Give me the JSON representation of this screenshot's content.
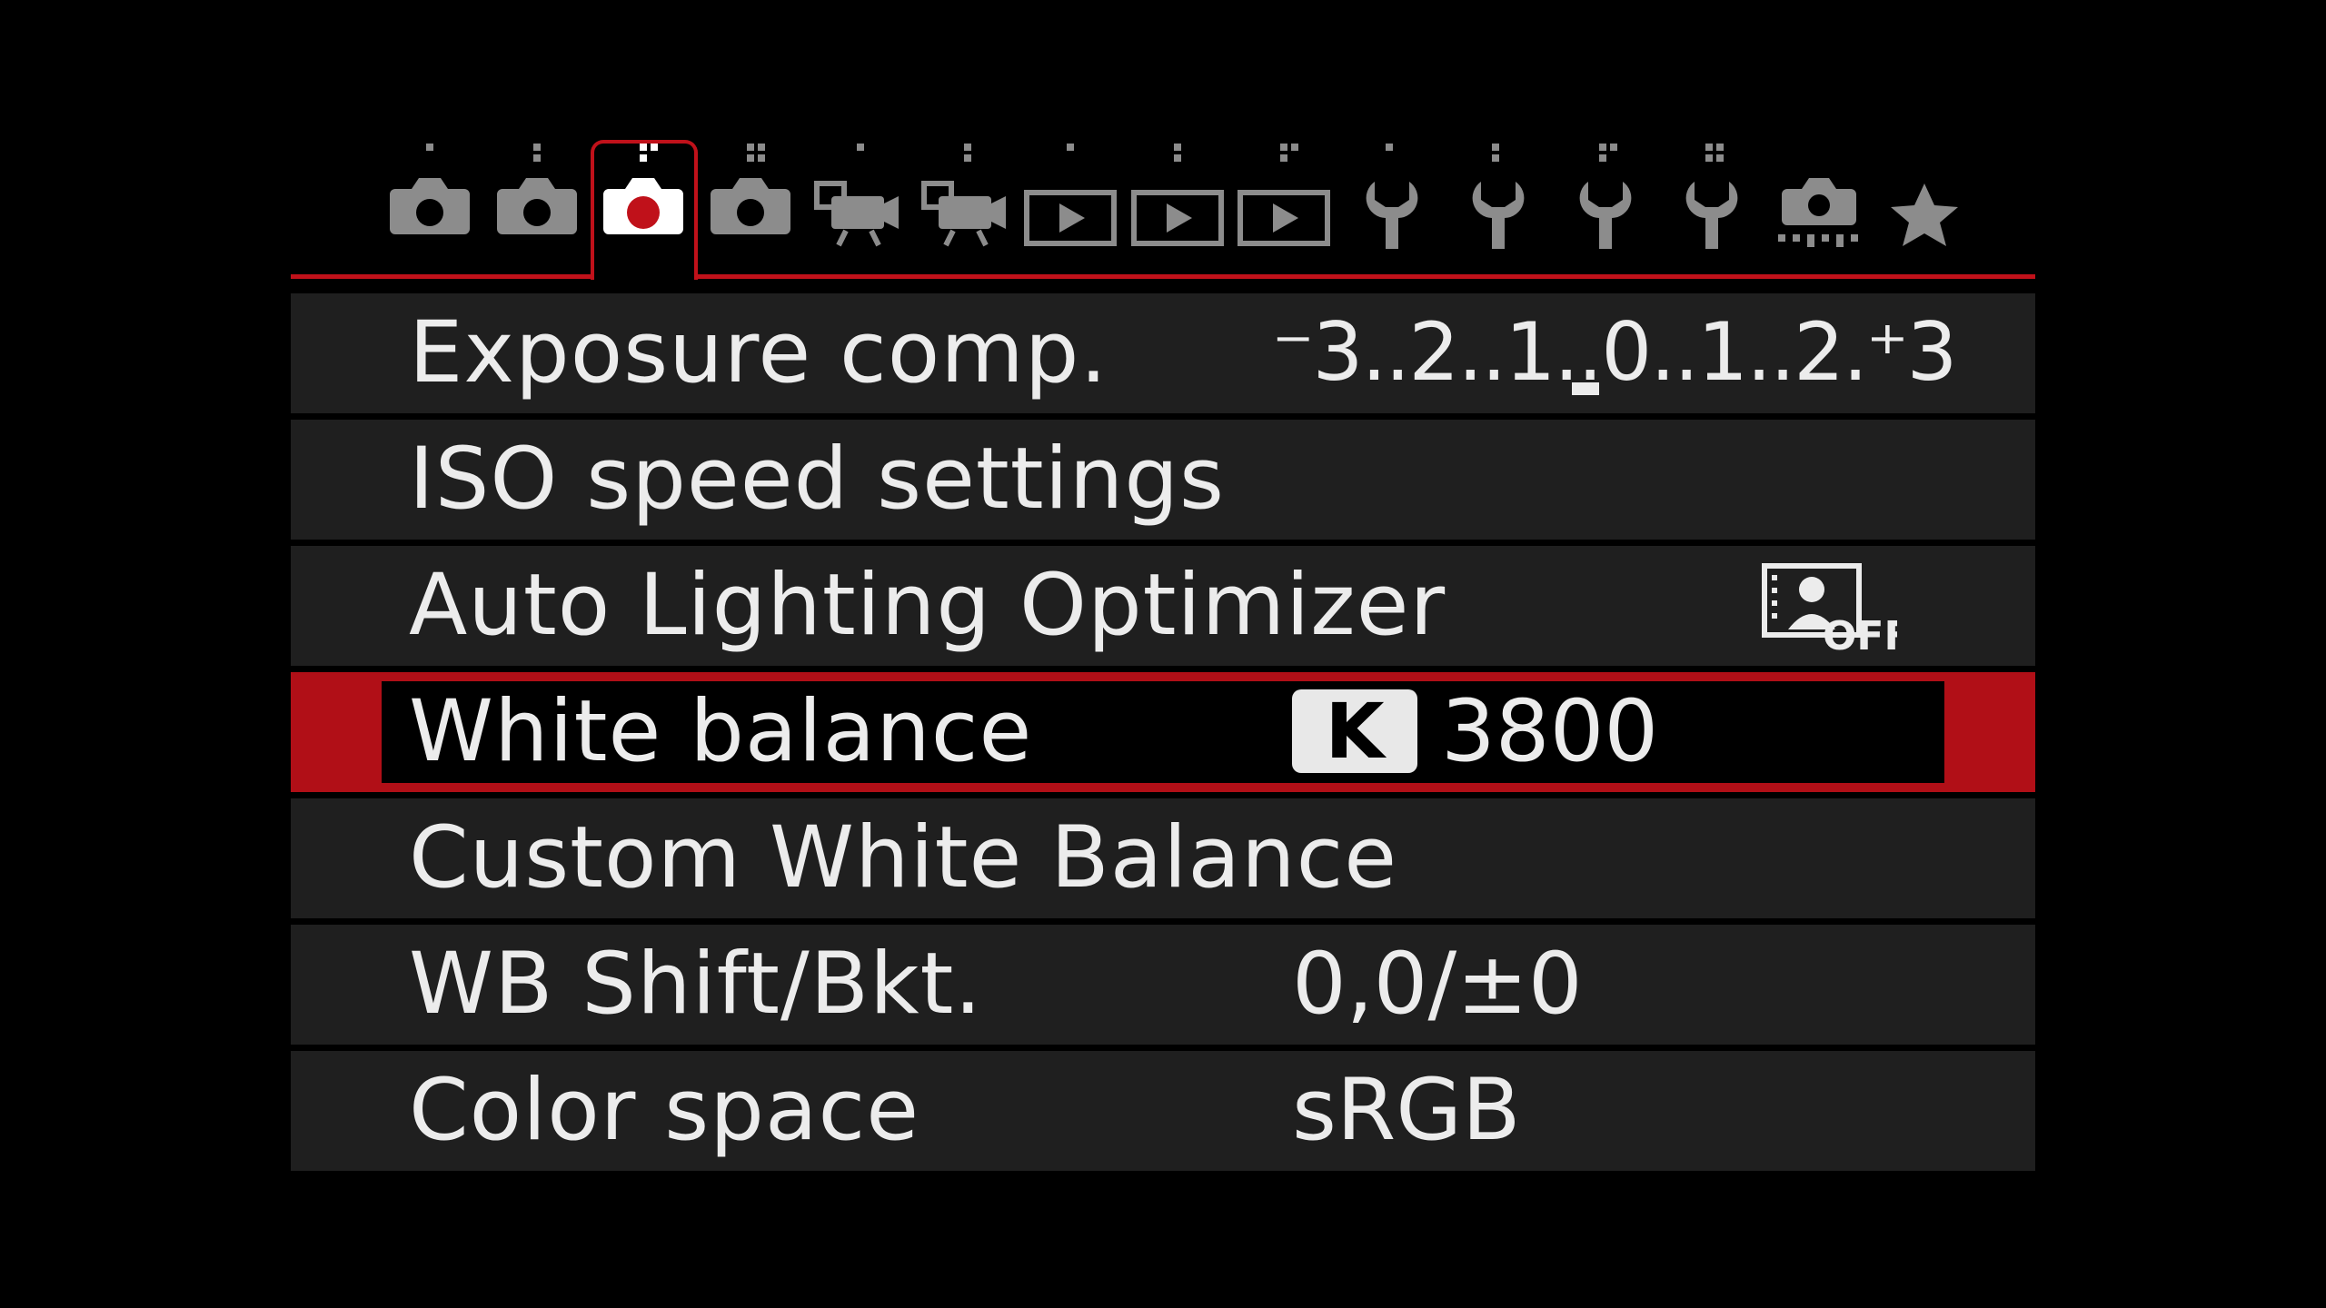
{
  "tabs": [
    {
      "icon": "camera-1-icon",
      "active": false
    },
    {
      "icon": "camera-2-icon",
      "active": false
    },
    {
      "icon": "camera-3-icon",
      "active": true
    },
    {
      "icon": "camera-4-icon",
      "active": false
    },
    {
      "icon": "movie-camera-1-icon",
      "active": false
    },
    {
      "icon": "movie-camera-2-icon",
      "active": false
    },
    {
      "icon": "playback-1-icon",
      "active": false
    },
    {
      "icon": "playback-2-icon",
      "active": false
    },
    {
      "icon": "playback-3-icon",
      "active": false
    },
    {
      "icon": "wrench-1-icon",
      "active": false
    },
    {
      "icon": "wrench-2-icon",
      "active": false
    },
    {
      "icon": "wrench-3-icon",
      "active": false
    },
    {
      "icon": "wrench-4-icon",
      "active": false
    },
    {
      "icon": "custom-functions-icon",
      "active": false
    },
    {
      "icon": "my-menu-star-icon",
      "active": false
    }
  ],
  "colors": {
    "accent": "#c0111a",
    "row_bg": "#1f1f1f",
    "text": "#ececec"
  },
  "rows": {
    "exposure": {
      "label": "Exposure comp.",
      "scale": "⁻3..2..1..0..1..2.⁺3",
      "current_ev": 0
    },
    "iso": {
      "label": "ISO speed settings"
    },
    "alo": {
      "label": "Auto Lighting Optimizer",
      "value_icon": "alo-off-icon",
      "icon_text": "OFF"
    },
    "wb": {
      "label": "White balance",
      "badge": "K",
      "value": "3800"
    },
    "custom_wb": {
      "label": "Custom White Balance"
    },
    "wb_shift": {
      "label": "WB Shift/Bkt.",
      "value": "0,0/±0"
    },
    "color_space": {
      "label": "Color space",
      "value": "sRGB"
    }
  }
}
